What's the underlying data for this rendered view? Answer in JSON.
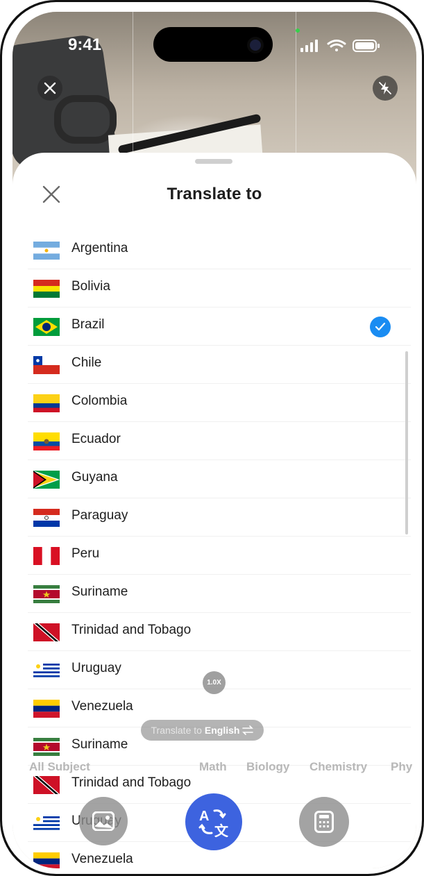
{
  "status_bar": {
    "time": "9:41"
  },
  "sheet": {
    "title": "Translate to"
  },
  "countries": [
    {
      "name": "Argentina",
      "flag": "argentina-flag-icon",
      "selected": false
    },
    {
      "name": "Bolivia",
      "flag": "bolivia-flag-icon",
      "selected": false
    },
    {
      "name": "Brazil",
      "flag": "brazil-flag-icon",
      "selected": true
    },
    {
      "name": "Chile",
      "flag": "chile-flag-icon",
      "selected": false
    },
    {
      "name": "Colombia",
      "flag": "colombia-flag-icon",
      "selected": false
    },
    {
      "name": "Ecuador",
      "flag": "ecuador-flag-icon",
      "selected": false
    },
    {
      "name": "Guyana",
      "flag": "guyana-flag-icon",
      "selected": false
    },
    {
      "name": "Paraguay",
      "flag": "paraguay-flag-icon",
      "selected": false
    },
    {
      "name": "Peru",
      "flag": "peru-flag-icon",
      "selected": false
    },
    {
      "name": "Suriname",
      "flag": "suriname-flag-icon",
      "selected": false
    },
    {
      "name": "Trinidad and Tobago",
      "flag": "trinidad-and-tobago-flag-icon",
      "selected": false
    },
    {
      "name": "Uruguay",
      "flag": "uruguay-flag-icon",
      "selected": false
    },
    {
      "name": "Venezuela",
      "flag": "venezuela-flag-icon",
      "selected": false
    },
    {
      "name": "Suriname",
      "flag": "suriname-flag-icon",
      "selected": false
    },
    {
      "name": "Trinidad and Tobago",
      "flag": "trinidad-and-tobago-flag-icon",
      "selected": false
    },
    {
      "name": "Uruguay",
      "flag": "uruguay-flag-icon",
      "selected": false
    },
    {
      "name": "Venezuela",
      "flag": "venezuela-flag-icon",
      "selected": false
    }
  ],
  "camera": {
    "zoom_label": "1.0X",
    "translate_prefix": "Translate to",
    "translate_language": "English",
    "subjects": [
      "All Subject",
      "Math",
      "Biology",
      "Chemistry",
      "Phy"
    ]
  },
  "colors": {
    "accent": "#3d63df",
    "check": "#1a8cf2",
    "text": "#1e1e1e"
  }
}
